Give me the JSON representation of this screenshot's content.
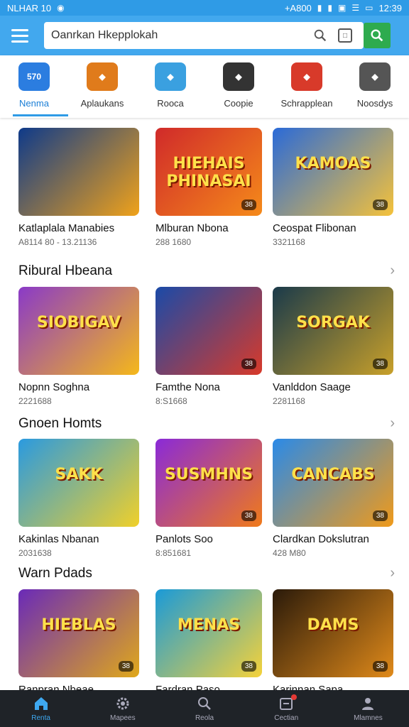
{
  "statusbar": {
    "carrier": "NLHAR 10",
    "network": "+A800",
    "time": "12:39"
  },
  "search": {
    "value": "Oanrkan Hkepplokah"
  },
  "categories": [
    {
      "label": "Nenma",
      "icon": "570",
      "color": "#2b7de0",
      "active": true
    },
    {
      "label": "Aplaukans",
      "icon": "arcade-icon",
      "color": "#e07b1b"
    },
    {
      "label": "Rooca",
      "icon": "robot-icon",
      "color": "#3aa0e0"
    },
    {
      "label": "Coopie",
      "icon": "clipboard-icon",
      "color": "#333333"
    },
    {
      "label": "Schrapplean",
      "icon": "badge-icon",
      "color": "#d83a2a"
    },
    {
      "label": "Noosdys",
      "icon": "shield-icon",
      "color": "#555555"
    }
  ],
  "top_row": [
    {
      "name": "Katlaplala Manabies",
      "meta": "A8114 80 - 13.21136",
      "thumb_text": "",
      "badge": "",
      "grad": [
        "#0e3a8a",
        "#f0a21a"
      ]
    },
    {
      "name": "Mlburan Nbona",
      "meta": "288 1680",
      "thumb_text": "HIEHAIS PHINASAI",
      "badge": "38",
      "grad": [
        "#d02a2a",
        "#f58a1a"
      ]
    },
    {
      "name": "Ceospat Flibonan",
      "meta": "3321168",
      "thumb_text": "KAMOAS",
      "badge": "38",
      "grad": [
        "#2a6ad8",
        "#f5c23a"
      ]
    }
  ],
  "sections": [
    {
      "title": "Ribural Hbeana",
      "items": [
        {
          "name": "Nopnn Soghna",
          "meta": "2221688",
          "thumb_text": "SIOBIGAV",
          "badge": "",
          "grad": [
            "#8a3ac8",
            "#f5b81a"
          ]
        },
        {
          "name": "Famthe Nona",
          "meta": "8:S1668",
          "thumb_text": "",
          "badge": "38",
          "grad": [
            "#1a4aa8",
            "#d83a2a"
          ]
        },
        {
          "name": "Vanlddon Saage",
          "meta": "2281168",
          "thumb_text": "SORGAK",
          "badge": "38",
          "grad": [
            "#1a3a4a",
            "#c8a02a"
          ]
        }
      ]
    },
    {
      "title": "Gnoen Homts",
      "items": [
        {
          "name": "Kakinlas Nbanan",
          "meta": "2031638",
          "thumb_text": "SAKK",
          "badge": "",
          "grad": [
            "#2a9ae0",
            "#f0d02a"
          ]
        },
        {
          "name": "Panlots Soo",
          "meta": "8:851681",
          "thumb_text": "SUSMHNS",
          "badge": "38",
          "grad": [
            "#8a2ad8",
            "#f07a1a"
          ]
        },
        {
          "name": "Clardkan Dokslutran",
          "meta": "428 M80",
          "thumb_text": "CANCABS",
          "badge": "38",
          "grad": [
            "#2a8ae8",
            "#f09a1a"
          ]
        }
      ]
    },
    {
      "title": "Warn Pdads",
      "items": [
        {
          "name": "Ranpran Nbeae",
          "meta": "",
          "thumb_text": "HIEBLAS",
          "badge": "38",
          "grad": [
            "#6a2ab8",
            "#e0a81a"
          ]
        },
        {
          "name": "Fardran Paso",
          "meta": "",
          "thumb_text": "MENAS",
          "badge": "38",
          "grad": [
            "#1a9ad8",
            "#f5d23a"
          ]
        },
        {
          "name": "Karinnan Sapa",
          "meta": "",
          "thumb_text": "DAMS",
          "badge": "38",
          "grad": [
            "#2a1a0a",
            "#e08a1a"
          ]
        }
      ]
    }
  ],
  "bottomnav": [
    {
      "label": "Renta",
      "icon": "home-icon",
      "active": true
    },
    {
      "label": "Mapees",
      "icon": "gear-icon"
    },
    {
      "label": "Reola",
      "icon": "search-icon"
    },
    {
      "label": "Cectian",
      "icon": "inbox-icon"
    },
    {
      "label": "Mlamnes",
      "icon": "profile-icon"
    }
  ],
  "colors": {
    "statusbar": "#2f9be6",
    "appbar": "#42a8ee",
    "search_button": "#2eab4e",
    "bottomnav": "#1f2328",
    "accent": "#2f9be6"
  }
}
